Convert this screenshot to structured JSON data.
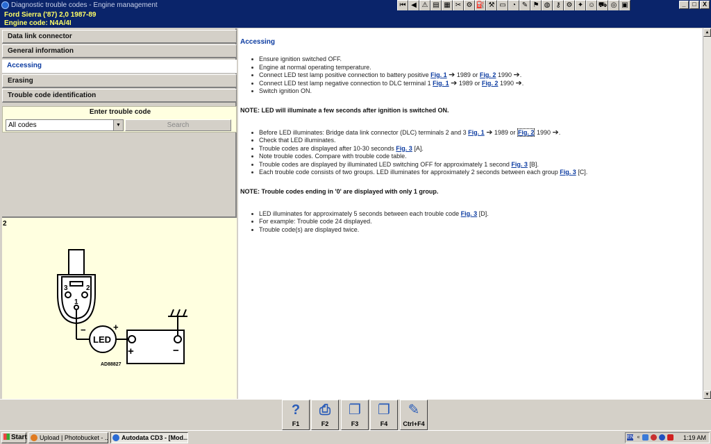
{
  "window": {
    "title": "Diagnostic trouble codes - Engine management",
    "toolbar_icons": [
      "first-icon",
      "prev-icon",
      "warning-icon",
      "doc-icon",
      "calendar-icon",
      "tools-icon",
      "engine-icon",
      "fuel-icon",
      "wrench-icon",
      "ruler-icon",
      "stopwatch-icon",
      "spray-icon",
      "car-icon",
      "brake-icon",
      "key-icon",
      "gear-icon",
      "bulb-icon",
      "person-icon",
      "car2-icon",
      "tyre-icon",
      "note-icon"
    ],
    "controls": {
      "minimize": "_",
      "maximize": "□",
      "close": "X"
    }
  },
  "vehicle": {
    "line1": "Ford   Sierra ('87) 2,0   1987-89",
    "line2": "Engine code: N4A/4I"
  },
  "sidebar": {
    "items": [
      {
        "label": "Data link connector",
        "active": false
      },
      {
        "label": "General information",
        "active": false
      },
      {
        "label": "Accessing",
        "active": true
      },
      {
        "label": "Erasing",
        "active": false
      },
      {
        "label": "Trouble code identification",
        "active": false
      }
    ]
  },
  "search": {
    "label": "Enter trouble code",
    "selected": "All codes",
    "button": "Search"
  },
  "figure": {
    "number": "2",
    "pin_3": "3",
    "pin_2": "2",
    "pin_1": "1",
    "led_label": "LED",
    "plus": "+",
    "minus": "−",
    "ref": "AD88827"
  },
  "content": {
    "heading": "Accessing",
    "list1": [
      {
        "parts": [
          {
            "t": "Ensure ignition switched OFF."
          }
        ]
      },
      {
        "parts": [
          {
            "t": "Engine at normal operating temperature."
          }
        ]
      },
      {
        "parts": [
          {
            "t": "Connect LED test lamp positive connection to battery positive "
          },
          {
            "fig": "Fig. 1"
          },
          {
            "t": " "
          },
          {
            "arrow": "➔"
          },
          {
            "t": " 1989 or "
          },
          {
            "fig": "Fig. 2"
          },
          {
            "t": " 1990 "
          },
          {
            "arrow": "➔"
          },
          {
            "t": "."
          }
        ]
      },
      {
        "parts": [
          {
            "t": "Connect LED test lamp negative connection to DLC terminal 1 "
          },
          {
            "fig": "Fig. 1"
          },
          {
            "t": " "
          },
          {
            "arrow": "➔"
          },
          {
            "t": " 1989 or "
          },
          {
            "fig": "Fig. 2"
          },
          {
            "t": " 1990 "
          },
          {
            "arrow": "➔"
          },
          {
            "t": "."
          }
        ]
      },
      {
        "parts": [
          {
            "t": "Switch ignition ON."
          }
        ]
      }
    ],
    "note1": "NOTE: LED will illuminate a few seconds after ignition is switched ON.",
    "list2": [
      {
        "parts": [
          {
            "t": "Before LED illuminates: Bridge data link connector (DLC) terminals 2 and 3 "
          },
          {
            "fig": "Fig. 1"
          },
          {
            "t": " "
          },
          {
            "arrow": "➔"
          },
          {
            "t": " 1989 or "
          },
          {
            "fig": "Fig. 2",
            "boxed": true
          },
          {
            "t": " 1990 "
          },
          {
            "arrow": "➔"
          },
          {
            "t": "."
          }
        ]
      },
      {
        "parts": [
          {
            "t": "Check that LED illuminates."
          }
        ]
      },
      {
        "parts": [
          {
            "t": "Trouble codes are displayed after 10-30 seconds "
          },
          {
            "fig": "Fig. 3"
          },
          {
            "t": " [A]."
          }
        ]
      },
      {
        "parts": [
          {
            "t": "Note trouble codes. Compare with trouble code table."
          }
        ]
      },
      {
        "parts": [
          {
            "t": "Trouble codes are displayed by illuminated LED switching OFF for approximately 1 second "
          },
          {
            "fig": "Fig. 3"
          },
          {
            "t": " [B]."
          }
        ]
      },
      {
        "parts": [
          {
            "t": "Each trouble code consists of two groups. LED illuminates for approximately 2 seconds between each group "
          },
          {
            "fig": "Fig. 3"
          },
          {
            "t": " [C]."
          }
        ]
      }
    ],
    "note2": "NOTE: Trouble codes ending in '0' are displayed with only 1 group.",
    "list3": [
      {
        "parts": [
          {
            "t": "LED illuminates for approximately 5 seconds between each trouble code "
          },
          {
            "fig": "Fig. 3"
          },
          {
            "t": " [D]."
          }
        ]
      },
      {
        "parts": [
          {
            "t": "For example: Trouble code 24 displayed."
          }
        ]
      },
      {
        "parts": [
          {
            "t": "Trouble code(s) are displayed twice."
          }
        ]
      }
    ]
  },
  "fkeys": [
    {
      "label": "F1",
      "icon": "help-icon",
      "glyph": "?"
    },
    {
      "label": "F2",
      "icon": "print-icon",
      "glyph": "⎙"
    },
    {
      "label": "F3",
      "icon": "copy-icon",
      "glyph": "❐"
    },
    {
      "label": "F4",
      "icon": "copy-all-icon",
      "glyph": "❐"
    },
    {
      "label": "Ctrl+F4",
      "icon": "notes-icon",
      "glyph": "✎"
    }
  ],
  "taskbar": {
    "start": "Start",
    "tasks": [
      {
        "label": "Upload | Photobucket - ...",
        "active": false
      },
      {
        "label": "Autodata CD3 - [Mod...",
        "active": true
      }
    ],
    "tray_lang": "EN",
    "tray_chevron": "«",
    "clock": "1:19 AM",
    "colors": {
      "title": "#0a246a",
      "vehicle_text": "#ffff66",
      "link": "#0a3aa0"
    }
  }
}
